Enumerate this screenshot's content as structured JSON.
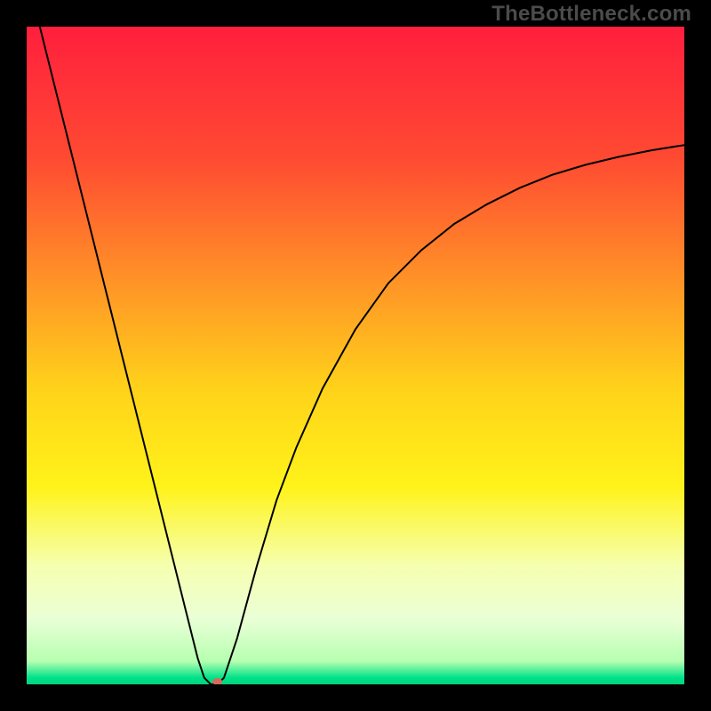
{
  "watermark": {
    "text": "TheBottleneck.com"
  },
  "chart_data": {
    "type": "line",
    "title": "",
    "xlabel": "",
    "ylabel": "",
    "xlim": [
      0,
      100
    ],
    "ylim": [
      0,
      100
    ],
    "legend": false,
    "grid": false,
    "background_gradient": {
      "stops": [
        {
          "offset": 0.0,
          "color": "#ff1f3d"
        },
        {
          "offset": 0.2,
          "color": "#ff4a32"
        },
        {
          "offset": 0.4,
          "color": "#ff9826"
        },
        {
          "offset": 0.55,
          "color": "#ffd21a"
        },
        {
          "offset": 0.7,
          "color": "#fff31a"
        },
        {
          "offset": 0.82,
          "color": "#f6ffb0"
        },
        {
          "offset": 0.9,
          "color": "#eaffd6"
        },
        {
          "offset": 0.965,
          "color": "#b6ffb0"
        },
        {
          "offset": 0.99,
          "color": "#00e28a"
        },
        {
          "offset": 1.0,
          "color": "#00d47c"
        }
      ]
    },
    "series": [
      {
        "name": "bottleneck-curve",
        "color": "#000000",
        "stroke_width": 2,
        "x": [
          2,
          4,
          6,
          8,
          10,
          12,
          14,
          16,
          18,
          20,
          22,
          24,
          26,
          27,
          28,
          29,
          30,
          32,
          35,
          38,
          41,
          45,
          50,
          55,
          60,
          65,
          70,
          75,
          80,
          85,
          90,
          95,
          100
        ],
        "y": [
          100,
          92,
          84,
          76,
          68,
          60,
          52,
          44,
          36,
          28,
          20,
          12,
          4,
          1,
          0,
          0,
          1,
          7,
          18,
          28,
          36,
          45,
          54,
          61,
          66,
          70,
          73,
          75.5,
          77.5,
          79,
          80.2,
          81.2,
          82
        ]
      }
    ],
    "marker": {
      "name": "optimum-point",
      "x": 29,
      "y": 0.4,
      "rx": 5.5,
      "ry": 4,
      "color": "#d46a5c"
    }
  }
}
